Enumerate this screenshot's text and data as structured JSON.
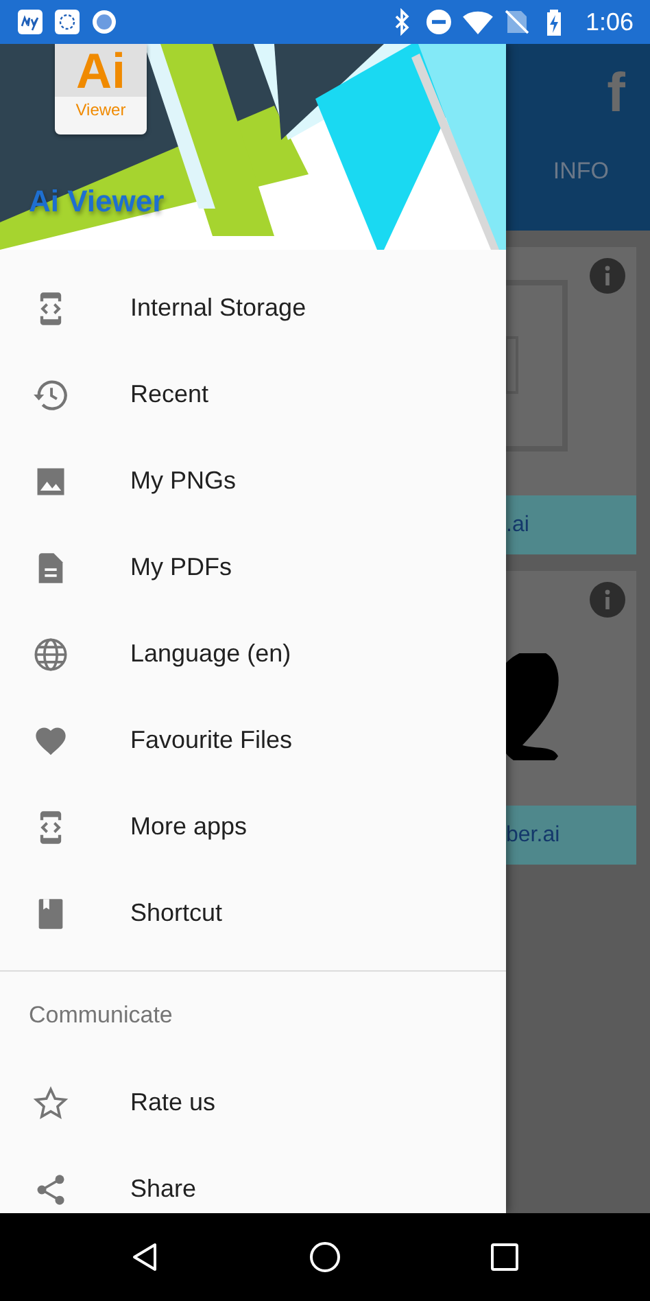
{
  "status_bar": {
    "time": "1:06"
  },
  "drawer": {
    "logo_main": "Ai",
    "logo_sub": "Viewer",
    "title": "Ai Viewer",
    "items": [
      {
        "label": "Internal Storage"
      },
      {
        "label": "Recent"
      },
      {
        "label": "My PNGs"
      },
      {
        "label": "My PDFs"
      },
      {
        "label": "Language (en)"
      },
      {
        "label": "Favourite Files"
      },
      {
        "label": "More apps"
      },
      {
        "label": "Shortcut"
      }
    ],
    "section": {
      "heading": "Communicate",
      "items": [
        {
          "label": "Rate us"
        },
        {
          "label": "Share"
        }
      ]
    }
  },
  "background_app": {
    "app_bar_glyph": "f",
    "tab": "INFO",
    "cards": [
      {
        "file_name": ".ai"
      },
      {
        "file_name": "ber.ai"
      }
    ]
  }
}
